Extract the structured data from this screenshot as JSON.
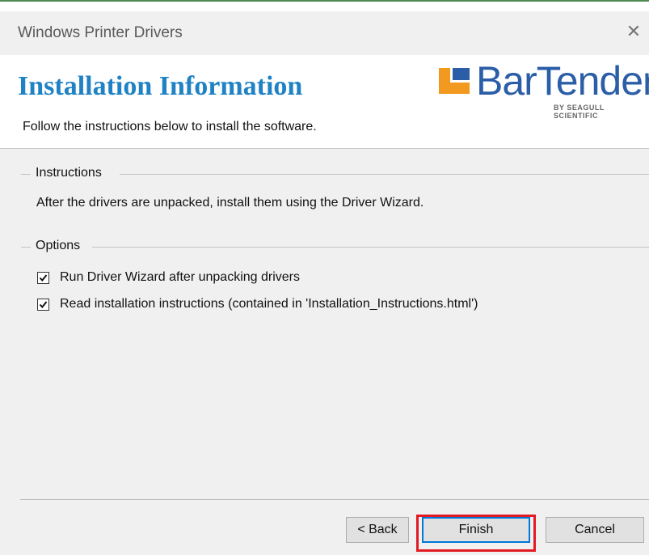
{
  "window": {
    "title": "Windows Printer Drivers",
    "close_icon": "close-icon"
  },
  "header": {
    "title": "Installation Information",
    "subtitle": "Follow the instructions below to install the software.",
    "logo": {
      "word": "BarTender",
      "tagline": "BY SEAGULL SCIENTIFIC",
      "registered_mark": "®"
    }
  },
  "instructions": {
    "group_label": "Instructions",
    "text": "After the drivers are unpacked, install them using the Driver Wizard."
  },
  "options": {
    "group_label": "Options",
    "items": [
      {
        "label": "Run Driver Wizard after unpacking drivers",
        "checked": true
      },
      {
        "label": "Read installation instructions (contained in 'Installation_Instructions.html')",
        "checked": true
      }
    ]
  },
  "buttons": {
    "back": "< Back",
    "finish": "Finish",
    "cancel": "Cancel"
  },
  "colors": {
    "title_blue": "#1f82c4",
    "logo_blue": "#2b5ea7",
    "logo_orange": "#f29a1f",
    "highlight_red": "#e21b23",
    "focus_blue": "#0078d7"
  }
}
